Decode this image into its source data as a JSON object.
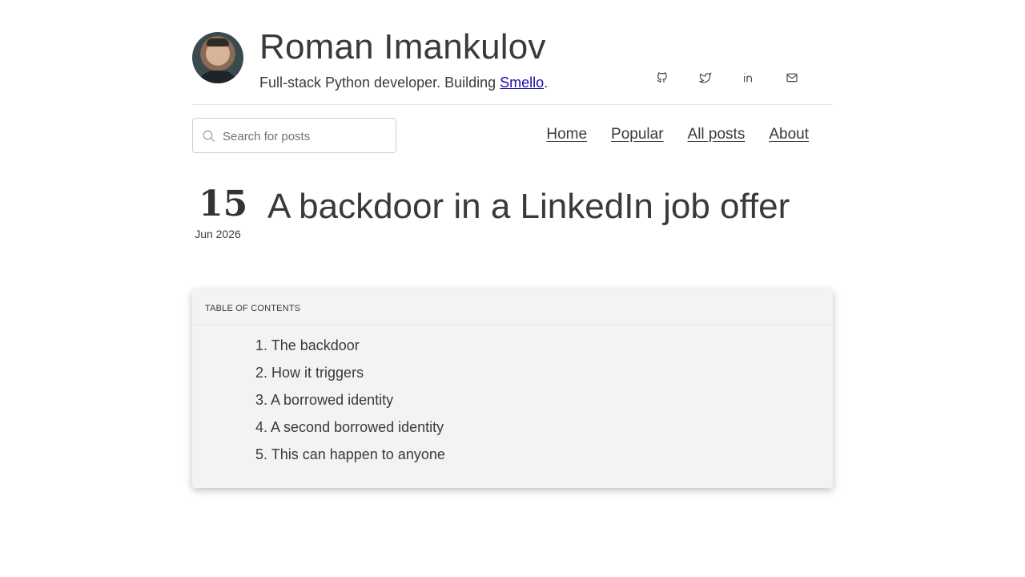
{
  "site": {
    "title": "Roman Imankulov",
    "tagline_prefix": "Full-stack Python developer. Building ",
    "tagline_link": "Smello",
    "tagline_suffix": "."
  },
  "social": [
    {
      "icon": "github-icon"
    },
    {
      "icon": "twitter-icon"
    },
    {
      "icon": "linkedin-icon"
    },
    {
      "icon": "mail-icon"
    }
  ],
  "search": {
    "placeholder": "Search for posts"
  },
  "nav": {
    "home": "Home",
    "popular": "Popular",
    "all_posts": "All posts",
    "about": "About"
  },
  "post": {
    "day": "15",
    "month_year": "Jun 2026",
    "title": "A backdoor in a LinkedIn job offer"
  },
  "toc": {
    "heading": "TABLE OF CONTENTS",
    "items": [
      {
        "num": "1.",
        "label": "The backdoor"
      },
      {
        "num": "2.",
        "label": "How it triggers"
      },
      {
        "num": "3.",
        "label": "A borrowed identity"
      },
      {
        "num": "4.",
        "label": "A second borrowed identity"
      },
      {
        "num": "5.",
        "label": "This can happen to anyone"
      }
    ]
  }
}
